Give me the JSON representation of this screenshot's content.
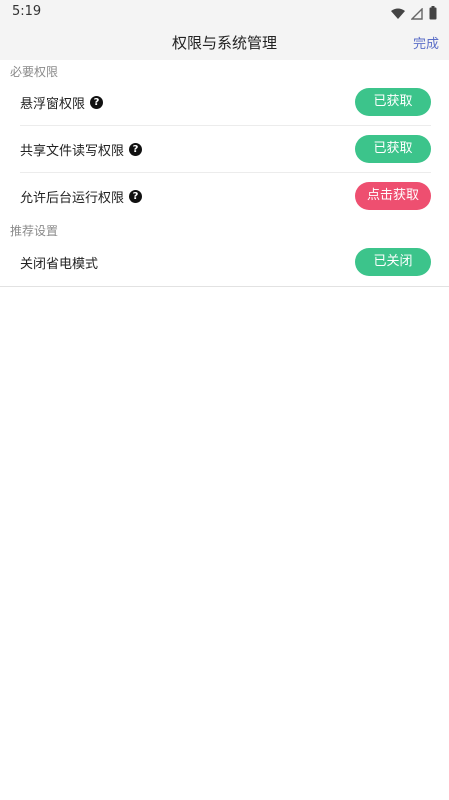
{
  "status_bar": {
    "time": "5:19",
    "icons": [
      "wifi-icon",
      "signal-icon",
      "battery-icon"
    ]
  },
  "header": {
    "title": "权限与系统管理",
    "done_label": "完成"
  },
  "sections": [
    {
      "title": "必要权限",
      "rows": [
        {
          "label": "悬浮窗权限",
          "help": true,
          "button": "已获取",
          "state": "granted"
        },
        {
          "label": "共享文件读写权限",
          "help": true,
          "button": "已获取",
          "state": "granted"
        },
        {
          "label": "允许后台运行权限",
          "help": true,
          "button": "点击获取",
          "state": "request"
        }
      ]
    },
    {
      "title": "推荐设置",
      "rows": [
        {
          "label": "关闭省电模式",
          "help": false,
          "button": "已关闭",
          "state": "done"
        }
      ]
    }
  ],
  "colors": {
    "accent_link": "#5b6ec7",
    "granted_green": "#3cc48b",
    "request_red": "#ee4f70",
    "section_gray": "#8a8a8a"
  }
}
